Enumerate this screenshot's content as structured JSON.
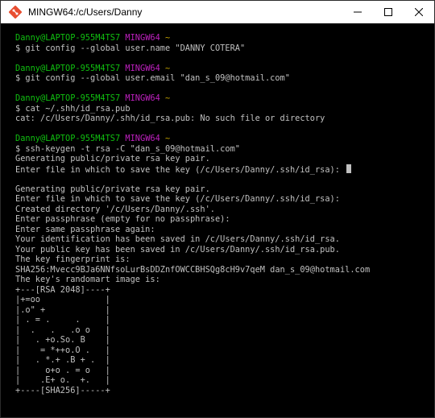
{
  "window": {
    "title": "MINGW64:/c/Users/Danny",
    "icon": "mingw-git-icon",
    "controls": [
      "minimize",
      "maximize",
      "close"
    ]
  },
  "terminal": {
    "blocks": [
      {
        "prompt": {
          "user": "Danny@LAPTOP-955M4TS7",
          "env": "MINGW64",
          "path": "~"
        },
        "command": "$ git config --global user.name \"DANNY COTERA\"",
        "output": [],
        "blank_after": true
      },
      {
        "prompt": {
          "user": "Danny@LAPTOP-955M4TS7",
          "env": "MINGW64",
          "path": "~"
        },
        "command": "$ git config --global user.email \"dan_s_09@hotmail.com\"",
        "output": [],
        "blank_after": true
      },
      {
        "prompt": {
          "user": "Danny@LAPTOP-955M4TS7",
          "env": "MINGW64",
          "path": "~"
        },
        "command": "$ cat ~/.shh/id_rsa.pub",
        "output": [
          "cat: /c/Users/Danny/.shh/id_rsa.pub: No such file or directory"
        ],
        "blank_after": true
      },
      {
        "prompt": {
          "user": "Danny@LAPTOP-955M4TS7",
          "env": "MINGW64",
          "path": "~"
        },
        "command": "$ ssh-keygen -t rsa -C \"dan_s_09@hotmail.com\"",
        "output": [
          "Generating public/private rsa key pair.",
          "Enter file in which to save the key (/c/Users/Danny/.ssh/id_rsa): "
        ],
        "cursor": true,
        "blank_after": true
      }
    ],
    "tail": [
      "Generating public/private rsa key pair.",
      "Enter file in which to save the key (/c/Users/Danny/.ssh/id_rsa):",
      "Created directory '/c/Users/Danny/.ssh'.",
      "Enter passphrase (empty for no passphrase):",
      "Enter same passphrase again:",
      "Your identification has been saved in /c/Users/Danny/.ssh/id_rsa.",
      "Your public key has been saved in /c/Users/Danny/.ssh/id_rsa.pub.",
      "The key fingerprint is:",
      "SHA256:Mvecc9BJa6NNfsoLurBsDDZnfOWCCBHSQg8cH9v7qeM dan_s_09@hotmail.com",
      "The key's randomart image is:",
      "+---[RSA 2048]----+",
      "|+=oo             |",
      "|.o\" +            |",
      "| . = .     .     |",
      "|  .   .   .o o   |",
      "|   . +o.So. B    |",
      "|    = *++o.O .   |",
      "|   . *.+ .B + .  |",
      "|     o+o . = o   |",
      "|    .E+ o.  +.   |",
      "+----[SHA256]-----+"
    ]
  },
  "colors": {
    "background": "#000000",
    "text": "#c0c0c0",
    "prompt_user": "#10c010",
    "prompt_env": "#c020c0",
    "prompt_path": "#c0a000"
  }
}
